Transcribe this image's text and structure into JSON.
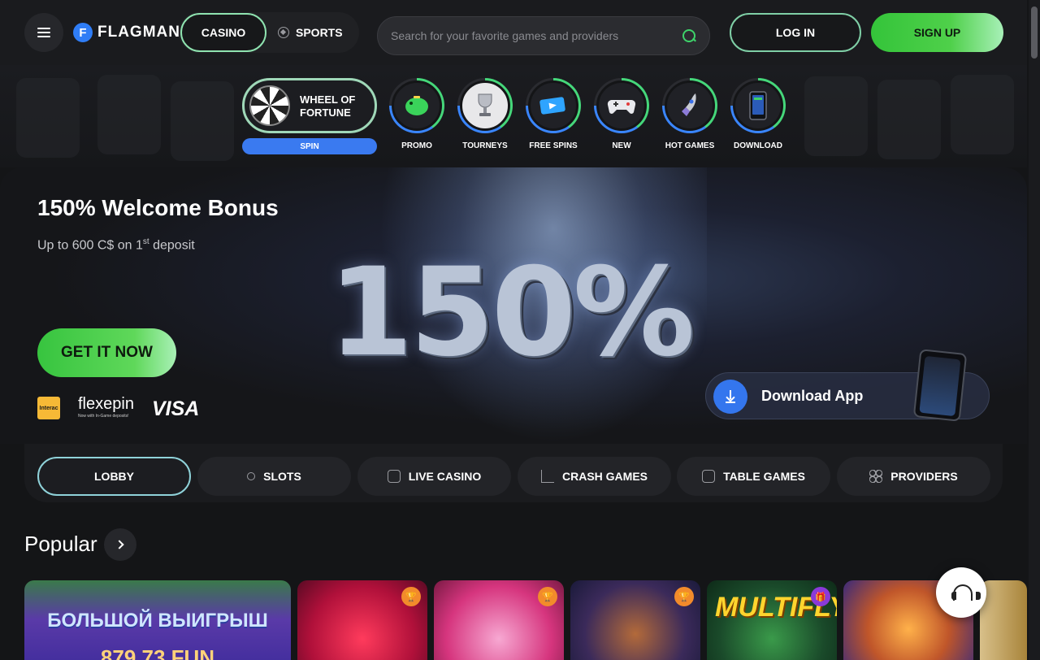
{
  "header": {
    "logo_mark": "F",
    "logo_text": "FLAGMAN",
    "mode_casino": "CASINO",
    "mode_sports": "SPORTS",
    "search_placeholder": "Search for your favorite games and providers",
    "login_label": "LOG IN",
    "signup_label": "SIGN UP"
  },
  "quick_links": {
    "wheel_label": "WHEEL OF FORTUNE",
    "spin_label": "SPIN",
    "items": [
      {
        "label": "PROMO",
        "icon": "piggy-bank-icon"
      },
      {
        "label": "TOURNEYS",
        "icon": "trophy-icon"
      },
      {
        "label": "FREE SPINS",
        "icon": "ticket-icon"
      },
      {
        "label": "NEW",
        "icon": "gamepad-icon"
      },
      {
        "label": "HOT GAMES",
        "icon": "rocket-icon"
      },
      {
        "label": "DOWNLOAD",
        "icon": "phone-icon"
      }
    ]
  },
  "hero": {
    "title": "150% Welcome Bonus",
    "subtitle_prefix": "Up to 600 C$ on 1",
    "subtitle_sup": "st",
    "subtitle_suffix": " deposit",
    "big_text": "150%",
    "cta_label": "GET IT NOW",
    "payment_interac": "Interac",
    "payment_flexepin": "flexepin",
    "payment_flexepin_sub": "Now with In-Game deposits!",
    "payment_visa": "VISA",
    "app_label": "Download App"
  },
  "categories": [
    {
      "label": "LOBBY",
      "icon": ""
    },
    {
      "label": "SLOTS",
      "icon": "cherry-icon"
    },
    {
      "label": "LIVE CASINO",
      "icon": "live-icon"
    },
    {
      "label": "CRASH GAMES",
      "icon": "chart-icon"
    },
    {
      "label": "TABLE GAMES",
      "icon": "dice-icon"
    },
    {
      "label": "PROVIDERS",
      "icon": "grid-icon"
    }
  ],
  "popular": {
    "title": "Popular",
    "games": [
      {
        "text": "БОЛЬШОЙ ВЫИГРЫШ",
        "text2": "879.73 FUN"
      },
      {
        "text": "",
        "text2": ""
      },
      {
        "text": "",
        "text2": ""
      },
      {
        "text": "",
        "text2": ""
      },
      {
        "text": "MULTIFLY!",
        "text2": ""
      },
      {
        "text": "",
        "text2": ""
      }
    ]
  },
  "colors": {
    "accent_green": "#3ed36a",
    "accent_blue": "#3476ee",
    "background": "#141517"
  }
}
